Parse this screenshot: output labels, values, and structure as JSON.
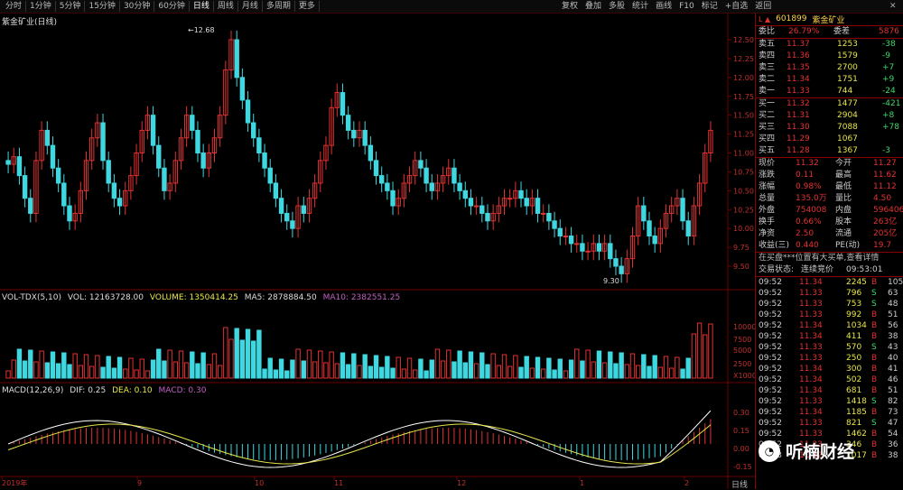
{
  "toolbar": {
    "periods": [
      "分时",
      "1分钟",
      "5分钟",
      "15分钟",
      "30分钟",
      "60分钟",
      "日线",
      "周线",
      "月线",
      "多周期",
      "更多"
    ],
    "right": [
      "复权",
      "叠加",
      "多股",
      "统计",
      "画线",
      "F10",
      "标记",
      "+自选",
      "返回"
    ]
  },
  "chart_title": "紫金矿业(日线)",
  "price_labels": [
    "12.50",
    "12.25",
    "12.00",
    "11.75",
    "11.50",
    "11.25",
    "11.00",
    "10.75",
    "10.50",
    "10.25",
    "10.00",
    "9.75",
    "9.50"
  ],
  "high_label": "12.68",
  "low_label": "9.30",
  "vol_indicator": {
    "name": "VOL-TDX(5,10)",
    "vol": "VOL: 12163728.00",
    "volume": "VOLUME: 1350414.25",
    "ma5": "MA5: 2878884.50",
    "ma10": "MA10: 2382551.25"
  },
  "vol_labels": [
    "10000",
    "7500",
    "5000",
    "2500",
    "X1000"
  ],
  "macd_indicator": {
    "name": "MACD(12,26,9)",
    "dif": "DIF: 0.25",
    "dea": "DEA: 0.10",
    "macd": "MACD: 0.30"
  },
  "macd_labels": [
    "0.30",
    "0.15",
    "0.00",
    "-0.15"
  ],
  "date_labels": [
    "2019年",
    "9",
    "10",
    "11",
    "12",
    "1",
    "2"
  ],
  "panel": {
    "code": "601899",
    "name": "紫金矿业",
    "weibi_label": "委比",
    "weibi_value": "26.79%",
    "weicha_label": "委差",
    "weicha_value": "5876",
    "asks": [
      {
        "label": "卖五",
        "price": "11.37",
        "vol": "1253",
        "chg": "-38"
      },
      {
        "label": "卖四",
        "price": "11.36",
        "vol": "1579",
        "chg": "-9"
      },
      {
        "label": "卖三",
        "price": "11.35",
        "vol": "2700",
        "chg": "+7"
      },
      {
        "label": "卖二",
        "price": "11.34",
        "vol": "1751",
        "chg": "+9"
      },
      {
        "label": "卖一",
        "price": "11.33",
        "vol": "744",
        "chg": "-24"
      }
    ],
    "bids": [
      {
        "label": "买一",
        "price": "11.32",
        "vol": "1477",
        "chg": "-421"
      },
      {
        "label": "买二",
        "price": "11.31",
        "vol": "2904",
        "chg": "+8"
      },
      {
        "label": "买三",
        "price": "11.30",
        "vol": "7088",
        "chg": "+78"
      },
      {
        "label": "买四",
        "price": "11.29",
        "vol": "1067",
        "chg": ""
      },
      {
        "label": "买五",
        "price": "11.28",
        "vol": "1367",
        "chg": "-3"
      }
    ],
    "stats": [
      {
        "l1": "现价",
        "v1": "11.32",
        "l2": "今开",
        "v2": "11.27"
      },
      {
        "l1": "涨跌",
        "v1": "0.11",
        "l2": "最高",
        "v2": "11.62"
      },
      {
        "l1": "涨幅",
        "v1": "0.98%",
        "l2": "最低",
        "v2": "11.12"
      },
      {
        "l1": "总量",
        "v1": "135.0万",
        "l2": "量比",
        "v2": "4.50"
      },
      {
        "l1": "外盘",
        "v1": "754008",
        "l2": "内盘",
        "v2": "596406"
      },
      {
        "l1": "换手",
        "v1": "0.66%",
        "l2": "股本",
        "v2": "263亿"
      },
      {
        "l1": "净资",
        "v1": "2.50",
        "l2": "流通",
        "v2": "205亿"
      },
      {
        "l1": "收益(三)",
        "v1": "0.440",
        "l2": "PE(动)",
        "v2": "19.7"
      }
    ],
    "notice": "在买盘***位置有大买单,查看详情",
    "status_label": "交易状态:",
    "status_value": "连续竞价",
    "status_time": "09:53:01"
  },
  "ticks": [
    {
      "t": "09:52",
      "p": "11.34",
      "v": "2245",
      "d": "B",
      "n": "105"
    },
    {
      "t": "09:52",
      "p": "11.33",
      "v": "796",
      "d": "S",
      "n": "63"
    },
    {
      "t": "09:52",
      "p": "11.33",
      "v": "753",
      "d": "S",
      "n": "48"
    },
    {
      "t": "09:52",
      "p": "11.33",
      "v": "992",
      "d": "B",
      "n": "51"
    },
    {
      "t": "09:52",
      "p": "11.34",
      "v": "1034",
      "d": "B",
      "n": "56"
    },
    {
      "t": "09:52",
      "p": "11.34",
      "v": "411",
      "d": "B",
      "n": "38"
    },
    {
      "t": "09:52",
      "p": "11.33",
      "v": "570",
      "d": "S",
      "n": "43"
    },
    {
      "t": "09:52",
      "p": "11.33",
      "v": "250",
      "d": "B",
      "n": "40"
    },
    {
      "t": "09:52",
      "p": "11.34",
      "v": "300",
      "d": "B",
      "n": "41"
    },
    {
      "t": "09:52",
      "p": "11.34",
      "v": "502",
      "d": "B",
      "n": "46"
    },
    {
      "t": "09:52",
      "p": "11.34",
      "v": "681",
      "d": "B",
      "n": "51"
    },
    {
      "t": "09:52",
      "p": "11.33",
      "v": "1418",
      "d": "S",
      "n": "82"
    },
    {
      "t": "09:52",
      "p": "11.34",
      "v": "1185",
      "d": "B",
      "n": "73"
    },
    {
      "t": "09:52",
      "p": "11.33",
      "v": "821",
      "d": "S",
      "n": "47"
    },
    {
      "t": "09:52",
      "p": "11.33",
      "v": "1462",
      "d": "B",
      "n": "54"
    },
    {
      "t": "09:52",
      "p": "11.33",
      "v": "346",
      "d": "B",
      "n": "36"
    },
    {
      "t": "09:53",
      "p": "11.32",
      "v": "1017",
      "d": "B",
      "n": "38"
    }
  ],
  "watermark": "听楠财经",
  "bottom_right": "日线",
  "colors": {
    "up": "#e23232",
    "down": "#3fd8e0",
    "grid": "#6b0000",
    "ma5": "#ffffff",
    "ma10": "#e6e64a",
    "vol_ma10": "#c060c0"
  }
}
